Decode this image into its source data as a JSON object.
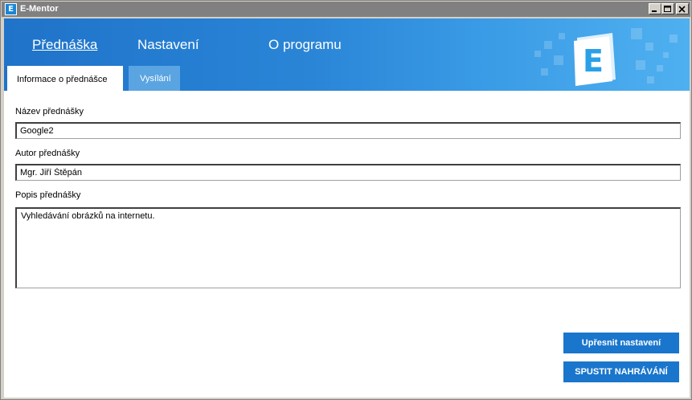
{
  "window": {
    "title": "E-Mentor",
    "app_icon_letter": "E"
  },
  "nav": {
    "items": [
      {
        "label": "Přednáška",
        "active": true
      },
      {
        "label": "Nastavení",
        "active": false
      },
      {
        "label": "O programu",
        "active": false
      }
    ]
  },
  "tabs": [
    {
      "label": "Informace o přednášce",
      "active": true
    },
    {
      "label": "Vysílání",
      "active": false
    }
  ],
  "form": {
    "title_label": "Název přednášky",
    "title_value": "Google2",
    "author_label": "Autor přednášky",
    "author_value": "Mgr. Jiří Štěpán",
    "description_label": "Popis přednášky",
    "description_value": "Vyhledávání obrázků na internetu."
  },
  "buttons": {
    "settings_label": "Upřesnit nastavení",
    "record_label": "SPUSTIT NAHRÁVÁNÍ"
  },
  "logo": {
    "letter": "E"
  },
  "colors": {
    "header_start": "#1f73c9",
    "header_end": "#4fb0f0",
    "button": "#1a76cc",
    "logo_letter": "#2aa0e8"
  },
  "icons": {
    "minimize": "minimize-icon",
    "maximize": "maximize-icon",
    "close": "close-icon"
  }
}
